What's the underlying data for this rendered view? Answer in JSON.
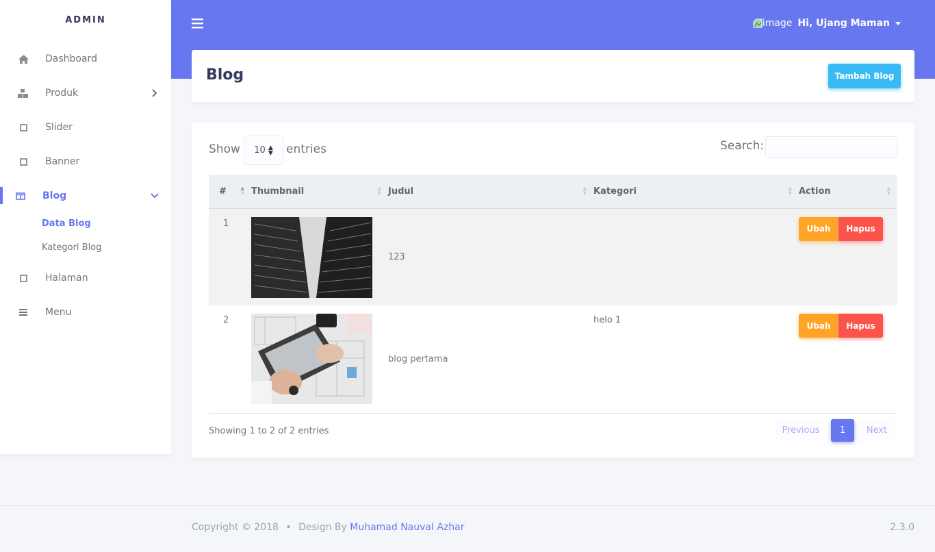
{
  "sidebar": {
    "brand": "ADMIN",
    "items": [
      {
        "label": "Dashboard",
        "icon": "home-icon"
      },
      {
        "label": "Produk",
        "icon": "boxes-icon"
      },
      {
        "label": "Slider",
        "icon": "square-icon"
      },
      {
        "label": "Banner",
        "icon": "square-icon"
      },
      {
        "label": "Blog",
        "icon": "columns-icon"
      },
      {
        "label": "Halaman",
        "icon": "square-icon"
      },
      {
        "label": "Menu",
        "icon": "bars-icon"
      }
    ],
    "blog_submenu": [
      "Data Blog",
      "Kategori Blog"
    ]
  },
  "topbar": {
    "avatar_alt": "image",
    "user_greeting": "Hi, Ujang Maman"
  },
  "section": {
    "title": "Blog",
    "add_button": "Tambah Blog"
  },
  "datatable": {
    "show_label": "Show",
    "entries_value": "10",
    "entries_label": "entries",
    "search_label": "Search:",
    "columns": [
      "#",
      "Thumbnail",
      "Judul",
      "Kategori",
      "Action"
    ],
    "rows": [
      {
        "num": "1",
        "judul": "123",
        "kategori": "",
        "thumbnail": "buildings-photo"
      },
      {
        "num": "2",
        "judul": "blog pertama",
        "kategori": "helo 1",
        "thumbnail": "laptop-blueprint-photo"
      }
    ],
    "edit_label": "Ubah",
    "delete_label": "Hapus",
    "info": "Showing 1 to 2 of 2 entries",
    "pagination": {
      "previous": "Previous",
      "current": "1",
      "next": "Next"
    }
  },
  "footer": {
    "copyright": "Copyright © 2018",
    "design_by": "Design By",
    "author": "Muhamad Nauval Azhar",
    "version": "2.3.0"
  },
  "colors": {
    "primary": "#6777ef",
    "info": "#3abaf4",
    "warning": "#ffa426",
    "danger": "#fc544b"
  }
}
